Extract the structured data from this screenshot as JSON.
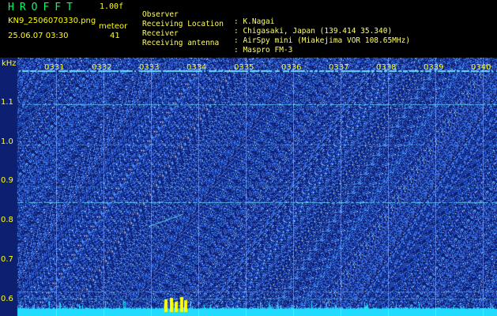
{
  "header": {
    "brand": "HROFFT",
    "version": "1.00f",
    "filename": "KN9_2506070330.png",
    "datetime": "25.06.07 03:30",
    "meteor_label": "meteor",
    "meteor_count": "41"
  },
  "meta": [
    {
      "key": "Observer",
      "value": ": K.Nagai"
    },
    {
      "key": "Receiving Location",
      "value": ": Chigasaki, Japan (139.414 35.340)"
    },
    {
      "key": "Receiver",
      "value": ": AirSpy mini (Miakejima VOR 108.65MHz)"
    },
    {
      "key": "Receiving antenna",
      "value": ": Maspro FM-3"
    }
  ],
  "spectrogram": {
    "y_unit": "kHz",
    "y_ticks": [
      "1.1",
      "1.0",
      "0.9",
      "0.8",
      "0.7",
      "0.6"
    ],
    "x_ticks": [
      "0331",
      "0332",
      "0333",
      "0334",
      "0335",
      "0336",
      "0337",
      "0338",
      "0339",
      "0340"
    ],
    "colors": {
      "background": "#0d1f70",
      "noise": "#2b57ff",
      "line": "#6fe6ff",
      "baseline": "#22dcff",
      "label": "#ffff00"
    }
  }
}
